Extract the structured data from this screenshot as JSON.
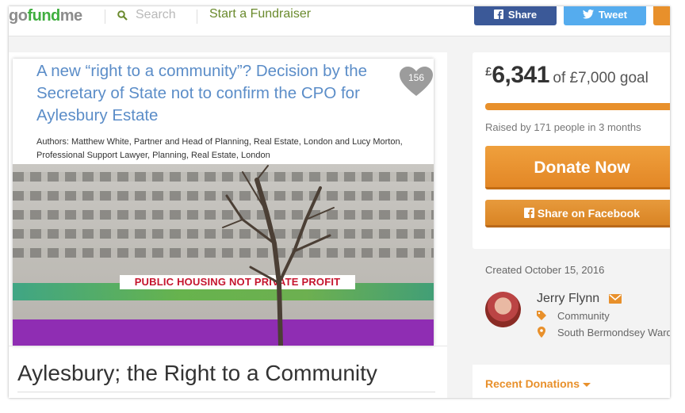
{
  "nav": {
    "logo_go": "go",
    "logo_fund": "fund",
    "logo_me": "me",
    "search_placeholder": "Search",
    "start_label": "Start a Fundraiser",
    "share_label": "Share",
    "tweet_label": "Tweet"
  },
  "article": {
    "title": "A new “right to a community”? Decision by the Secretary of State not to confirm the CPO for Aylesbury Estate",
    "authors": "Authors: Matthew White, Partner and Head of Planning, Real Estate, London and Lucy Morton, Professional Support Lawyer, Planning, Real Estate, London",
    "heart_count": "156",
    "banner_text": "PUBLIC HOUSING NOT PRIVATE PROFIT"
  },
  "campaign": {
    "title": "Aylesbury; the Right to a Community"
  },
  "donation": {
    "currency": "£",
    "amount": "6,341",
    "goal_text": "of £7,000 goal",
    "progress_percent": 90.6,
    "raised_by": "Raised by 171 people in 3 months",
    "donate_label": "Donate Now",
    "share_fb_label": "Share on Facebook"
  },
  "organizer": {
    "created": "Created October 15, 2016",
    "name": "Jerry Flynn",
    "category": "Community",
    "location": "South Bermondsey Ward"
  },
  "recent": {
    "label": "Recent Donations"
  },
  "colors": {
    "accent": "#e8902b",
    "facebook": "#3b5998",
    "twitter": "#55acee",
    "link": "#5b8dc8"
  }
}
